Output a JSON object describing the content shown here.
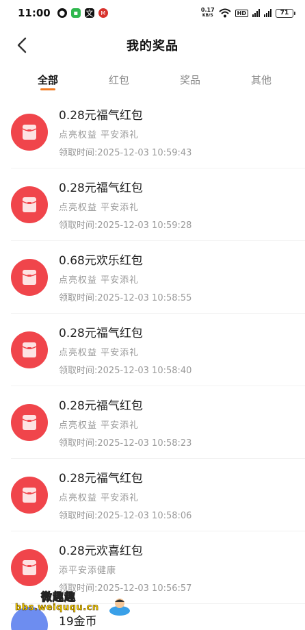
{
  "status_bar": {
    "time": "11:00",
    "net_speed_value": "0.17",
    "net_speed_unit": "KB/S",
    "hd_label": "HD",
    "battery": "71"
  },
  "header": {
    "title": "我的奖品"
  },
  "tabs": [
    {
      "label": "全部",
      "active": true
    },
    {
      "label": "红包",
      "active": false
    },
    {
      "label": "奖品",
      "active": false
    },
    {
      "label": "其他",
      "active": false
    }
  ],
  "prizes": [
    {
      "name": "0.28元福气红包",
      "desc": "点亮权益 平安添礼",
      "time": "领取时间:2025-12-03 10:59:43"
    },
    {
      "name": "0.28元福气红包",
      "desc": "点亮权益 平安添礼",
      "time": "领取时间:2025-12-03 10:59:28"
    },
    {
      "name": "0.68元欢乐红包",
      "desc": "点亮权益 平安添礼",
      "time": "领取时间:2025-12-03 10:58:55"
    },
    {
      "name": "0.28元福气红包",
      "desc": "点亮权益 平安添礼",
      "time": "领取时间:2025-12-03 10:58:40"
    },
    {
      "name": "0.28元福气红包",
      "desc": "点亮权益 平安添礼",
      "time": "领取时间:2025-12-03 10:58:23"
    },
    {
      "name": "0.28元福气红包",
      "desc": "点亮权益 平安添礼",
      "time": "领取时间:2025-12-03 10:58:06"
    },
    {
      "name": "0.28元欢喜红包",
      "desc": "添平安添健康",
      "time": "领取时间:2025-12-03 10:56:57"
    }
  ],
  "partial_item": {
    "name": "19金币"
  },
  "watermark": {
    "cn": "微趣趣",
    "url": "bbs.weiququ.cn"
  },
  "colors": {
    "accent": "#f07a22",
    "red_envelope": "#f0454b",
    "coin_icon": "#6d8df0"
  }
}
